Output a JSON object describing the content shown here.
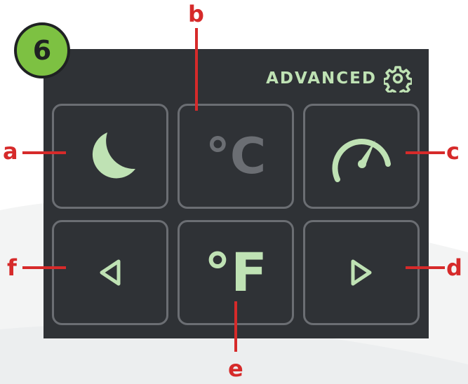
{
  "step_number": "6",
  "header": {
    "advanced_label": "ADVANCED",
    "icon": "gear-icon"
  },
  "buttons": [
    {
      "id": "sleep",
      "icon": "moon-icon"
    },
    {
      "id": "celsius",
      "text": "°C"
    },
    {
      "id": "speed",
      "icon": "speedometer-icon"
    },
    {
      "id": "fahrenheit",
      "text": "°F"
    },
    {
      "id": "previous",
      "icon": "triangle-left-icon"
    },
    {
      "id": "next",
      "icon": "triangle-right-icon"
    }
  ],
  "callouts": {
    "a": "a",
    "b": "b",
    "c": "c",
    "d": "d",
    "e": "e",
    "f": "f"
  },
  "colors": {
    "panel": "#2f3236",
    "active_icon": "#bfe2b4",
    "inactive_icon": "#6b6e73",
    "callout": "#d62a2a",
    "badge": "#7dc142"
  }
}
